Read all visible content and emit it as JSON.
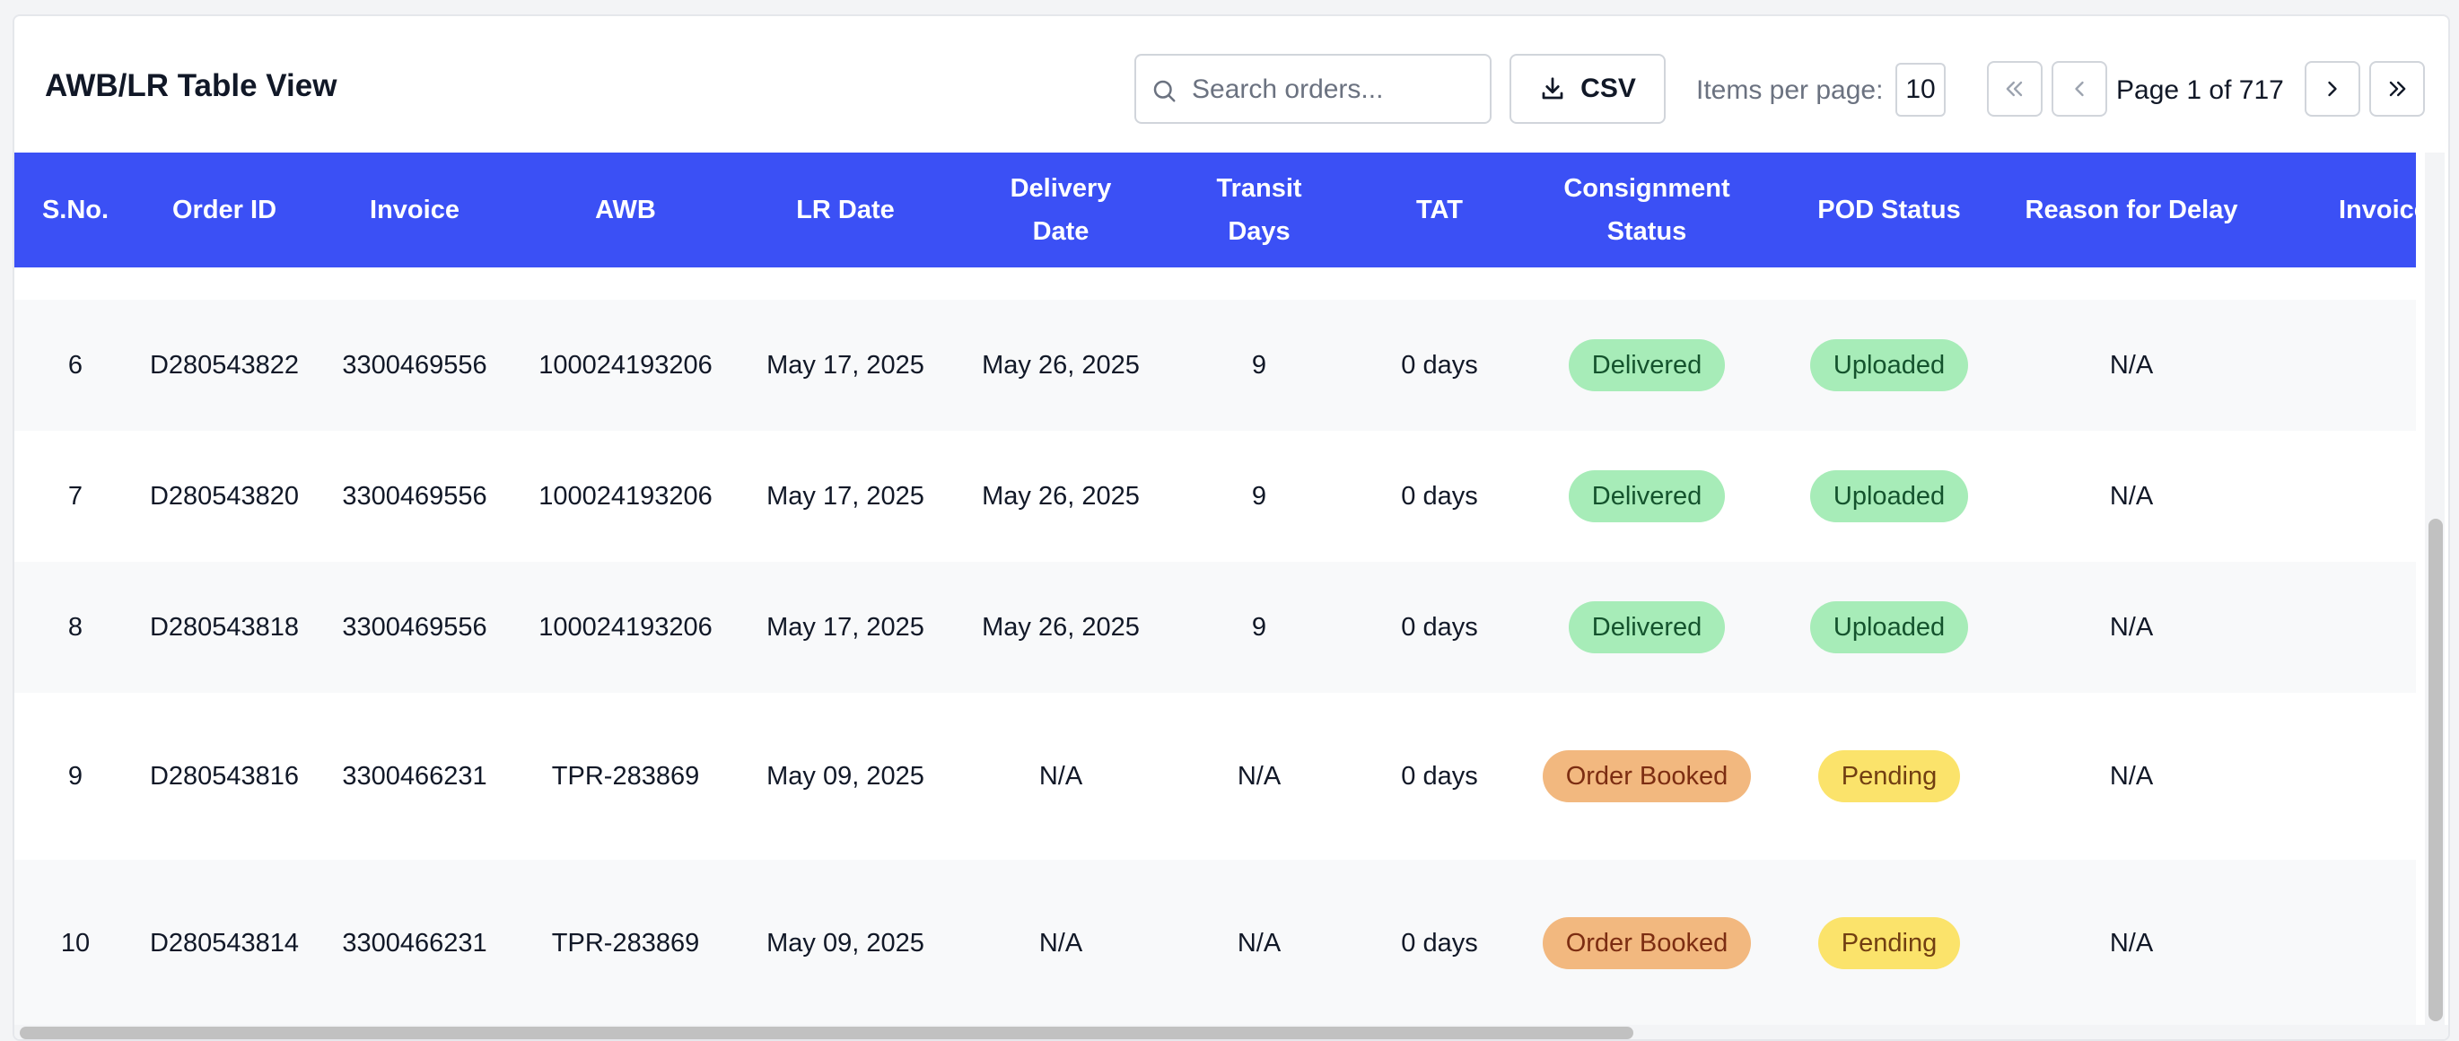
{
  "header": {
    "title": "AWB/LR Table View",
    "search_placeholder": "Search orders...",
    "csv_label": "CSV",
    "items_per_page_label": "Items per page:",
    "items_per_page_value": "10",
    "page_label": "Page 1 of 717"
  },
  "icons": {
    "search": "search-icon",
    "download": "download-icon",
    "first": "chevrons-left-icon",
    "prev": "chevron-left-icon",
    "next": "chevron-right-icon",
    "last": "chevrons-right-icon"
  },
  "colors": {
    "header_bg": "#3b50f5",
    "delivered": "#a7ecb8",
    "order_booked": "#f2b87f",
    "pending": "#fbe36b"
  },
  "table": {
    "columns": [
      "S.No.",
      "Order ID",
      "Invoice",
      "AWB",
      "LR Date",
      "Delivery\nDate",
      "Transit\nDays",
      "TAT",
      "Consignment\nStatus",
      "POD Status",
      "Reason for Delay",
      "Invoice"
    ],
    "rows": [
      {
        "sno": "6",
        "order_id": "D280543822",
        "invoice": "3300469556",
        "awb": "100024193206",
        "lr_date": "May 17, 2025",
        "delivery_date": "May 26, 2025",
        "transit_days": "9",
        "tat": "0 days",
        "consignment_status": "Delivered",
        "pod_status": "Uploaded",
        "reason": "N/A"
      },
      {
        "sno": "7",
        "order_id": "D280543820",
        "invoice": "3300469556",
        "awb": "100024193206",
        "lr_date": "May 17, 2025",
        "delivery_date": "May 26, 2025",
        "transit_days": "9",
        "tat": "0 days",
        "consignment_status": "Delivered",
        "pod_status": "Uploaded",
        "reason": "N/A"
      },
      {
        "sno": "8",
        "order_id": "D280543818",
        "invoice": "3300469556",
        "awb": "100024193206",
        "lr_date": "May 17, 2025",
        "delivery_date": "May 26, 2025",
        "transit_days": "9",
        "tat": "0 days",
        "consignment_status": "Delivered",
        "pod_status": "Uploaded",
        "reason": "N/A"
      },
      {
        "sno": "9",
        "order_id": "D280543816",
        "invoice": "3300466231",
        "awb": "TPR-283869",
        "lr_date": "May 09, 2025",
        "delivery_date": "N/A",
        "transit_days": "N/A",
        "tat": "0 days",
        "consignment_status": "Order Booked",
        "pod_status": "Pending",
        "reason": "N/A"
      },
      {
        "sno": "10",
        "order_id": "D280543814",
        "invoice": "3300466231",
        "awb": "TPR-283869",
        "lr_date": "May 09, 2025",
        "delivery_date": "N/A",
        "transit_days": "N/A",
        "tat": "0 days",
        "consignment_status": "Order Booked",
        "pod_status": "Pending",
        "reason": "N/A"
      }
    ]
  }
}
